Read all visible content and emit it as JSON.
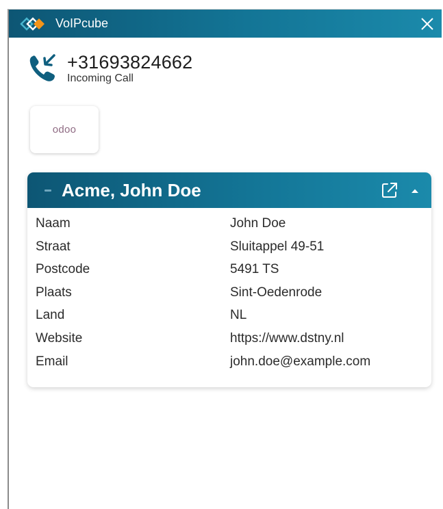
{
  "window": {
    "title": "VoIPcube",
    "close_icon": "close-icon",
    "logo_icon": "voipcube-logo-icon"
  },
  "call": {
    "number": "+31693824662",
    "status": "Incoming Call",
    "icon": "incoming-call-icon"
  },
  "apps": [
    {
      "name": "odoo"
    }
  ],
  "contact": {
    "title": "Acme, John Doe",
    "open_icon": "external-link-icon",
    "collapse_icon": "chevron-up-icon",
    "fields": [
      {
        "label": "Naam",
        "value": "John Doe"
      },
      {
        "label": "Straat",
        "value": "Sluitappel 49-51"
      },
      {
        "label": "Postcode",
        "value": "5491 TS"
      },
      {
        "label": "Plaats",
        "value": "Sint-Oedenrode"
      },
      {
        "label": "Land",
        "value": "NL"
      },
      {
        "label": "Website",
        "value": "https://www.dstny.nl"
      },
      {
        "label": "Email",
        "value": "john.doe@example.com"
      }
    ]
  },
  "colors": {
    "header_dark": "#0d5674",
    "header_light": "#1b8aab",
    "logo_orange": "#f39419",
    "logo_teal": "#48b6cf",
    "phone_icon": "#0f5f7f"
  }
}
